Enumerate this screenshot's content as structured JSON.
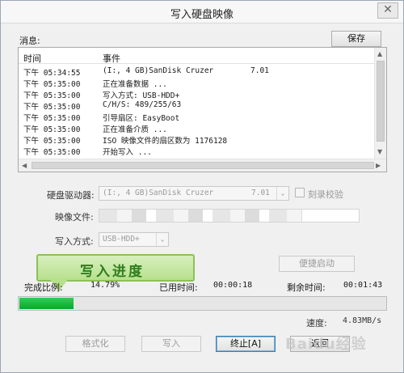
{
  "window": {
    "title": "写入硬盘映像",
    "close_label": "✕"
  },
  "messages": {
    "label": "消息:",
    "save_label": "保存",
    "columns": [
      "时间",
      "事件"
    ],
    "rows": [
      {
        "time": "下午 05:34:55",
        "event": "(I:, 4 GB)SanDisk Cruzer",
        "extra": "7.01"
      },
      {
        "time": "下午 05:35:00",
        "event": "正在准备数据 ...",
        "extra": ""
      },
      {
        "time": "下午 05:35:00",
        "event": "写入方式: USB-HDD+",
        "extra": ""
      },
      {
        "time": "下午 05:35:00",
        "event": "C/H/S: 489/255/63",
        "extra": ""
      },
      {
        "time": "下午 05:35:00",
        "event": "引导扇区: EasyBoot",
        "extra": ""
      },
      {
        "time": "下午 05:35:00",
        "event": "正在准备介质 ...",
        "extra": ""
      },
      {
        "time": "下午 05:35:00",
        "event": "ISO 映像文件的扇区数为 1176128",
        "extra": ""
      },
      {
        "time": "下午 05:35:00",
        "event": "开始写入 ...",
        "extra": ""
      }
    ]
  },
  "form": {
    "drive_label": "硬盘驱动器:",
    "drive_value": "(I:, 4 GB)SanDisk Cruzer",
    "drive_version": "7.01",
    "verify_label": "刻录校验",
    "image_label": "映像文件:",
    "method_label": "写入方式:",
    "method_value": "USB-HDD+",
    "quick_boot_label": "便捷启动"
  },
  "callout": {
    "text": "写入进度"
  },
  "progress": {
    "ratio_label": "完成比例:",
    "ratio_value": "14.79%",
    "fraction": 0.1479,
    "elapsed_label": "已用时间:",
    "elapsed_value": "00:00:18",
    "remaining_label": "剩余时间:",
    "remaining_value": "00:01:43",
    "speed_label": "速度:",
    "speed_value": "4.83MB/s",
    "fill_color": "#06a92f"
  },
  "buttons": {
    "format": "格式化",
    "write": "写入",
    "stop": "终止[A]",
    "back": "返回"
  },
  "watermark": "Baidu经验"
}
